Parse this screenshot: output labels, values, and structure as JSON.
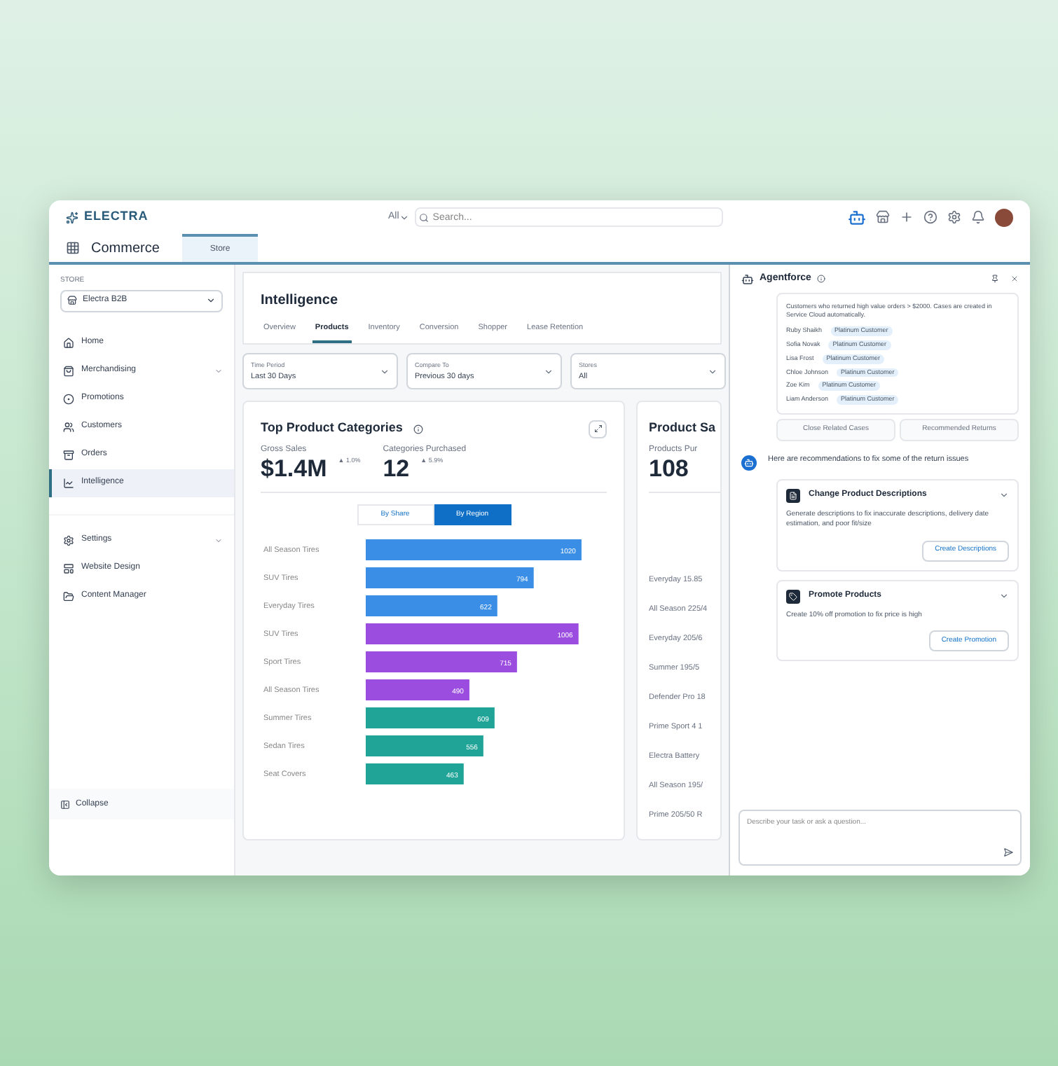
{
  "header": {
    "logo": "ELECTRA",
    "scope": "All",
    "search": {
      "placeholder": "Search..."
    }
  },
  "nav": {
    "app": "Commerce",
    "tabs": [
      {
        "label": "Store",
        "selected": true
      }
    ]
  },
  "sidebar": {
    "store_label": "STORE",
    "store": "Electra B2B",
    "groups": [
      [
        {
          "label": "Home",
          "kind": "home",
          "expandable": false,
          "selected": false
        },
        {
          "label": "Merchandising",
          "kind": "bag",
          "expandable": true,
          "selected": false
        },
        {
          "label": "Promotions",
          "kind": "promo",
          "expandable": false,
          "selected": false
        },
        {
          "label": "Customers",
          "kind": "people",
          "expandable": false,
          "selected": false
        },
        {
          "label": "Orders",
          "kind": "orders",
          "expandable": false,
          "selected": false
        },
        {
          "label": "Intelligence",
          "kind": "chart",
          "expandable": false,
          "selected": true
        }
      ],
      [
        {
          "label": "Settings",
          "kind": "gear",
          "expandable": true,
          "selected": false
        },
        {
          "label": "Website Design",
          "kind": "layout",
          "expandable": false,
          "selected": false
        },
        {
          "label": "Content Manager",
          "kind": "folder",
          "expandable": false,
          "selected": false
        }
      ]
    ],
    "collapse": "Collapse"
  },
  "page": {
    "title": "Intelligence",
    "tabs": [
      {
        "label": "Overview",
        "selected": false
      },
      {
        "label": "Products",
        "selected": true
      },
      {
        "label": "Inventory",
        "selected": false
      },
      {
        "label": "Conversion",
        "selected": false
      },
      {
        "label": "Shopper",
        "selected": false
      },
      {
        "label": "Lease Retention",
        "selected": false
      }
    ],
    "filters": [
      {
        "label": "Time Period",
        "value": "Last 30 Days"
      },
      {
        "label": "Compare To",
        "value": "Previous 30 days"
      },
      {
        "label": "Stores",
        "value": "All"
      }
    ],
    "categories_card": {
      "title": "Top Product Categories",
      "metrics": [
        {
          "label": "Gross Sales",
          "value": "$1.4M",
          "delta": "▲ 1.0%"
        },
        {
          "label": "Categories Purchased",
          "value": "12",
          "delta": "▲ 5.9%"
        }
      ],
      "toggle": [
        {
          "label": "By Share",
          "selected": false
        },
        {
          "label": "By Region",
          "selected": true
        }
      ],
      "chart_data": {
        "type": "bar",
        "orientation": "horizontal",
        "data_labels": true,
        "categories": [
          "All Season Tires",
          "SUV Tires",
          "Everyday Tires",
          "SUV Tires",
          "Sport Tires",
          "All Season Tires",
          "Summer Tires",
          "Sedan Tires",
          "Seat Covers"
        ],
        "series": [
          {
            "color": "#3a8ee6",
            "values": [
              1020,
              794,
              622,
              null,
              null,
              null,
              null,
              null,
              null
            ]
          },
          {
            "color": "#9b4de0",
            "values": [
              null,
              null,
              null,
              1006,
              715,
              490,
              null,
              null,
              null
            ]
          },
          {
            "color": "#1fa497",
            "values": [
              null,
              null,
              null,
              null,
              null,
              null,
              609,
              556,
              463
            ]
          }
        ]
      }
    },
    "sales_card": {
      "title": "Product Sa",
      "metric_label": "Products Pur",
      "metric_value": "108",
      "rows": [
        "Everyday 15.85",
        "All Season 225/4",
        "Everyday 205/6",
        "Summer 195/5",
        "Defender Pro 18",
        "Prime Sport 4 1",
        "Electra Battery",
        "All Season 195/",
        "Prime 205/50 R"
      ]
    }
  },
  "agent": {
    "title": "Agentforce",
    "summary": "Customers who returned high value orders > $2000. Cases are created in Service Cloud automatically.",
    "customers": [
      {
        "name": "Ruby Shaikh",
        "tag": "Platinum Customer"
      },
      {
        "name": "Sofia Novak",
        "tag": "Platinum Customer"
      },
      {
        "name": "Lisa Frost",
        "tag": "Platinum Customer"
      },
      {
        "name": "Chloe Johnson",
        "tag": "Platinum Customer"
      },
      {
        "name": "Zoe Kim",
        "tag": "Platinum Customer"
      },
      {
        "name": "Liam Anderson",
        "tag": "Platinum Customer"
      }
    ],
    "actions": [
      {
        "label": "Close Related Cases",
        "disabled": true
      },
      {
        "label": "Recommended Returns",
        "disabled": true
      }
    ],
    "message": "Here are recommendations to fix some of the return issues",
    "recommendations": [
      {
        "title": "Change Product Descriptions",
        "text": "Generate descriptions to fix inaccurate descriptions, delivery date estimation, and poor fit/size",
        "button": "Create Descriptions",
        "expanded": true
      },
      {
        "title": "Promote Products",
        "text": "Create 10% off promotion to fix price is high",
        "button": "Create Promotion",
        "expanded": true
      }
    ],
    "input": {
      "placeholder": "Describe your task or ask a question..."
    }
  }
}
